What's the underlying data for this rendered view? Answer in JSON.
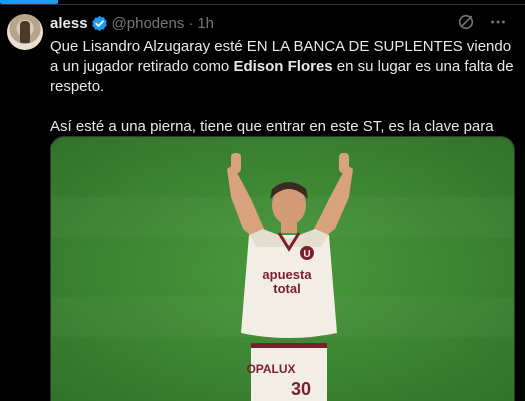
{
  "tweet": {
    "author_name": "aless",
    "handle": "@phodens",
    "separator": "·",
    "time": "1h",
    "text_p1": [
      {
        "t": "Que Lisandro Alzugaray esté EN LA BANCA DE SUPLENTES viendo a un jugador retirado como ",
        "b": false
      },
      {
        "t": "Edison Flores",
        "b": true
      },
      {
        "t": " en su lugar es una falta de respeto.",
        "b": false
      }
    ],
    "text_p2": "Así esté a una pierna, tiene que entrar en este ST, es la clave para ganar este partido.",
    "icons": [
      "verified-badge-icon",
      "grok-icon",
      "more-icon"
    ],
    "media": {
      "jersey_sponsor": "apuesta total",
      "jersey_sponsor_line1": "apuesta",
      "jersey_sponsor_line2": "total",
      "shorts_sponsor": "OPALUX",
      "shirt_number": "30",
      "crest": "U"
    }
  },
  "colors": {
    "background": "#000000",
    "text": "#e7e9ea",
    "muted": "#71767b",
    "accent": "#1d9bf0",
    "pitch": "#3f8a34",
    "jersey": "#f2eee6",
    "jersey_trim": "#7a1f2b"
  }
}
